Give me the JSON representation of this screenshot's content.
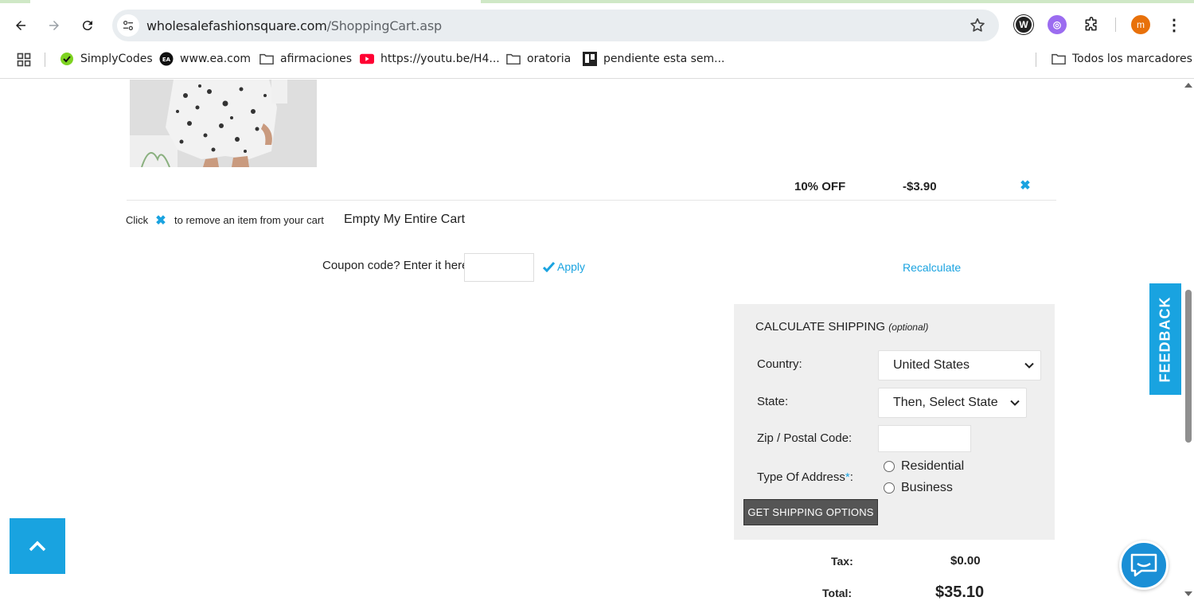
{
  "browser": {
    "url_domain": "wholesalefashionsquare.com",
    "url_path": "/ShoppingCart.asp",
    "profile_initial": "m",
    "bookmarks": [
      {
        "label": "SimplyCodes",
        "icon": "simplycodes-icon"
      },
      {
        "label": "www.ea.com",
        "icon": "ea-icon"
      },
      {
        "label": "afirmaciones",
        "icon": "folder-icon"
      },
      {
        "label": "https://youtu.be/H4...",
        "icon": "youtube-icon"
      },
      {
        "label": "oratoria",
        "icon": "folder-icon"
      },
      {
        "label": "pendiente esta sem...",
        "icon": "trello-icon"
      }
    ],
    "all_bookmarks": "Todos los marcadores"
  },
  "cart": {
    "discount_label": "10% OFF",
    "discount_amount": "-$3.90",
    "remove_hint_prefix": "Click",
    "remove_hint_suffix": "to remove an item from your cart",
    "empty_cart": "Empty My Entire Cart",
    "coupon_label": "Coupon code? Enter it here:",
    "coupon_value": "",
    "apply_label": "Apply",
    "recalculate_label": "Recalculate"
  },
  "shipping": {
    "title": "CALCULATE SHIPPING",
    "title_optional": "(optional)",
    "country_label": "Country:",
    "country_value": "United States",
    "state_label": "State:",
    "state_value": "Then, Select State",
    "zip_label": "Zip / Postal Code:",
    "zip_value": "",
    "address_type_label": "Type Of Address",
    "required_mark": "*",
    "address_type_suffix": ":",
    "address_options": [
      "Residential",
      "Business"
    ],
    "button_label": "GET SHIPPING OPTIONS"
  },
  "totals": {
    "tax_label": "Tax:",
    "tax_value": "$0.00",
    "total_label": "Total:",
    "total_value": "$35.10"
  },
  "widgets": {
    "feedback_label": "FEEDBACK"
  },
  "colors": {
    "accent": "#1aa3e0",
    "button_dark": "#555555",
    "panel_bg": "#efefef"
  }
}
